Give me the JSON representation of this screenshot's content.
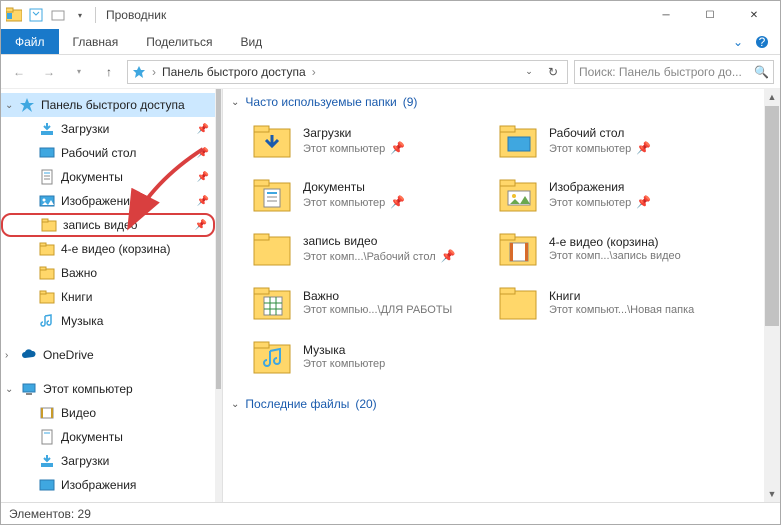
{
  "window": {
    "title": "Проводник"
  },
  "ribbon": {
    "file": "Файл",
    "tabs": [
      "Главная",
      "Поделиться",
      "Вид"
    ]
  },
  "address": {
    "crumb": "Панель быстрого доступа",
    "search_placeholder": "Поиск: Панель быстрого до..."
  },
  "nav": {
    "quick_access": "Панель быстрого доступа",
    "items": [
      {
        "label": "Загрузки",
        "pinned": true
      },
      {
        "label": "Рабочий стол",
        "pinned": true
      },
      {
        "label": "Документы",
        "pinned": true
      },
      {
        "label": "Изображения",
        "pinned": true
      },
      {
        "label": "запись видео",
        "pinned": true
      },
      {
        "label": "4-е видео (корзина)"
      },
      {
        "label": "Важно"
      },
      {
        "label": "Книги"
      },
      {
        "label": "Музыка"
      }
    ],
    "onedrive": "OneDrive",
    "thispc": "Этот компьютер",
    "thispc_children": [
      {
        "label": "Видео"
      },
      {
        "label": "Документы"
      },
      {
        "label": "Загрузки"
      },
      {
        "label": "Изображения"
      }
    ]
  },
  "sections": {
    "frequent": {
      "title": "Часто используемые папки",
      "count": "(9)"
    },
    "recent": {
      "title": "Последние файлы",
      "count": "(20)"
    }
  },
  "folders": [
    {
      "name": "Загрузки",
      "sub": "Этот компьютер",
      "pinned": true,
      "icon": "downloads"
    },
    {
      "name": "Рабочий стол",
      "sub": "Этот компьютер",
      "pinned": true,
      "icon": "desktop"
    },
    {
      "name": "Документы",
      "sub": "Этот компьютер",
      "pinned": true,
      "icon": "documents"
    },
    {
      "name": "Изображения",
      "sub": "Этот компьютер",
      "pinned": true,
      "icon": "pictures"
    },
    {
      "name": "запись видео",
      "sub": "Этот комп...\\Рабочий стол",
      "pinned": true,
      "icon": "folder"
    },
    {
      "name": "4-е видео (корзина)",
      "sub": "Этот комп...\\запись видео",
      "icon": "videos"
    },
    {
      "name": "Важно",
      "sub": "Этот компью...\\ДЛЯ РАБОТЫ",
      "icon": "excel"
    },
    {
      "name": "Книги",
      "sub": "Этот компьют...\\Новая папка",
      "icon": "folder"
    },
    {
      "name": "Музыка",
      "sub": "Этот компьютер",
      "icon": "music"
    }
  ],
  "status": {
    "elements_label": "Элементов:",
    "elements_count": "29"
  }
}
